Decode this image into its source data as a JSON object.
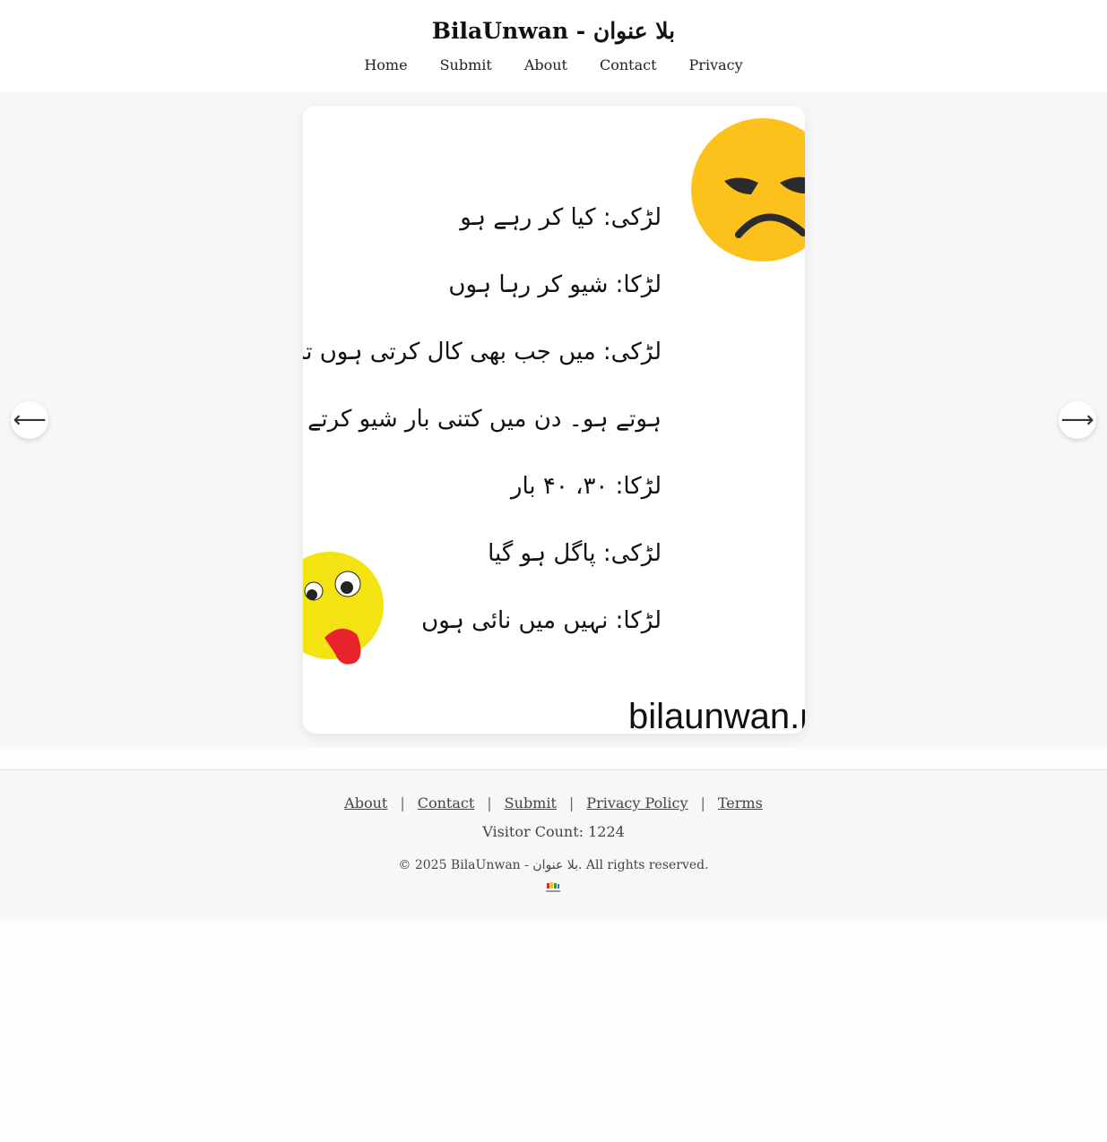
{
  "header": {
    "title": "BilaUnwan - بلا عنوان",
    "nav": [
      "Home",
      "Submit",
      "About",
      "Contact",
      "Privacy"
    ]
  },
  "post": {
    "lines": [
      "لڑکی: کیا کر رہے ہو",
      "لڑکا: شیو کر رہا ہوں",
      "لڑکی: میں جب بھی کال کرتی ہوں تم شیو کر رہے",
      "ہوتے ہو۔ دن میں کتنی بار شیو کرتے ہو۔",
      "لڑکا: ۳۰، ۴۰ بار",
      "لڑکی: پاگل ہو گیا",
      "لڑکا: نہیں میں نائی ہوں"
    ],
    "watermark": "bilaunwan.p",
    "emojis": [
      "angry-face-emoji",
      "tongue-out-emoji"
    ]
  },
  "carousel": {
    "prev": "⟵",
    "next": "⟶"
  },
  "footer": {
    "links": [
      "About",
      "Contact",
      "Submit",
      "Privacy Policy",
      "Terms"
    ],
    "separator": "|",
    "visitor_count": "Visitor Count: 1224",
    "copyright": "© 2025 BilaUnwan - بلا عنوان. All rights reserved."
  },
  "colors": {
    "emoji_yellow": "#fcc21b",
    "tongue_red": "#e8232b",
    "page_bg": "#f6f7f9"
  }
}
